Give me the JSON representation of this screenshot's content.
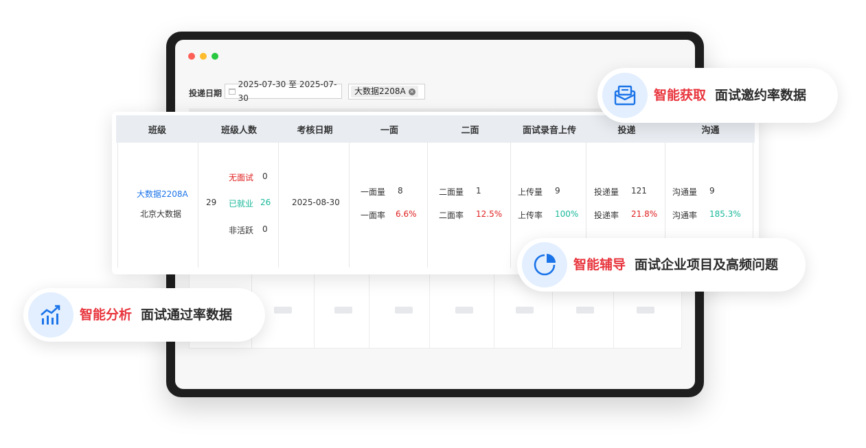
{
  "window": {
    "controls": [
      "close",
      "minimize",
      "maximize"
    ]
  },
  "filter": {
    "label": "投递日期",
    "date_range": "2025-07-30 至 2025-07-30",
    "tag": "大数据2208A"
  },
  "table": {
    "headers": [
      "班级",
      "班级人数",
      "考核日期",
      "一面",
      "二面",
      "面试录音上传",
      "投递",
      "沟通"
    ],
    "row": {
      "class_name": "大数据2208A",
      "campus": "北京大数据",
      "total": "29",
      "no_interview_label": "无面试",
      "no_interview": "0",
      "employed_label": "已就业",
      "employed": "26",
      "inactive_label": "非活跃",
      "inactive": "0",
      "date": "2025-08-30",
      "first_count_label": "一面量",
      "first_count": "8",
      "first_rate_label": "一面率",
      "first_rate": "6.6%",
      "second_count_label": "二面量",
      "second_count": "1",
      "second_rate_label": "二面率",
      "second_rate": "12.5%",
      "upload_count_label": "上传量",
      "upload_count": "9",
      "upload_rate_label": "上传率",
      "upload_rate": "100%",
      "deliver_count_label": "投递量",
      "deliver_count": "121",
      "deliver_rate_label": "投递率",
      "deliver_rate": "21.8%",
      "comm_count_label": "沟通量",
      "comm_count": "9",
      "comm_rate_label": "沟通率",
      "comm_rate": "185.3%"
    }
  },
  "features": [
    {
      "icon": "envelope-icon",
      "highlight": "智能获取",
      "text": "面试邀约率数据"
    },
    {
      "icon": "pie-chart-icon",
      "highlight": "智能辅导",
      "text": "面试企业项目及高频问题"
    },
    {
      "icon": "trend-chart-icon",
      "highlight": "智能分析",
      "text": "面试通过率数据"
    }
  ],
  "colors": {
    "accent_red": "#e8353d",
    "link_blue": "#1a73e8",
    "good_green": "#18b89a",
    "bad_red": "#e02020"
  }
}
